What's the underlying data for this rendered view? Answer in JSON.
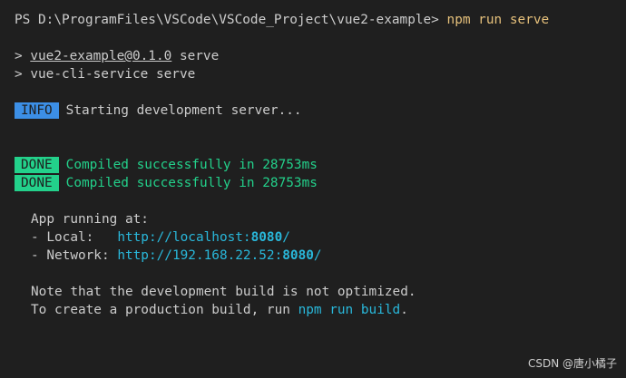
{
  "prompt": {
    "path": "PS D:\\ProgramFiles\\VSCode\\VSCode_Project\\vue2-example>",
    "command": "npm run serve"
  },
  "script_lines": [
    {
      "marker": "> ",
      "name": "vue2-example@0.1.0",
      "rest": " serve"
    },
    {
      "marker": "> ",
      "text": "vue-cli-service serve"
    }
  ],
  "info": {
    "badge": "INFO",
    "message": "Starting development server..."
  },
  "done": [
    {
      "badge": "DONE",
      "message": "Compiled successfully in 28753ms"
    },
    {
      "badge": "DONE",
      "message": "Compiled successfully in 28753ms"
    }
  ],
  "app": {
    "heading": "App running at:",
    "local_label": "- Local:   ",
    "local_url_prefix": "http://localhost:",
    "local_port": "8080",
    "local_url_suffix": "/",
    "network_label": "- Network: ",
    "network_url_prefix": "http://192.168.22.52:",
    "network_port": "8080",
    "network_url_suffix": "/"
  },
  "note": {
    "line1": "Note that the development build is not optimized.",
    "line2_prefix": "To create a production build, run ",
    "line2_cmd": "npm run build",
    "line2_suffix": "."
  },
  "watermark": "CSDN @唐小橘子",
  "colors": {
    "background": "#1f1f1f",
    "text": "#cccccc",
    "command": "#e5c07b",
    "info_badge": "#3c8fe6",
    "done_badge": "#23d18b",
    "success_text": "#23d18b",
    "url": "#29b8db"
  }
}
